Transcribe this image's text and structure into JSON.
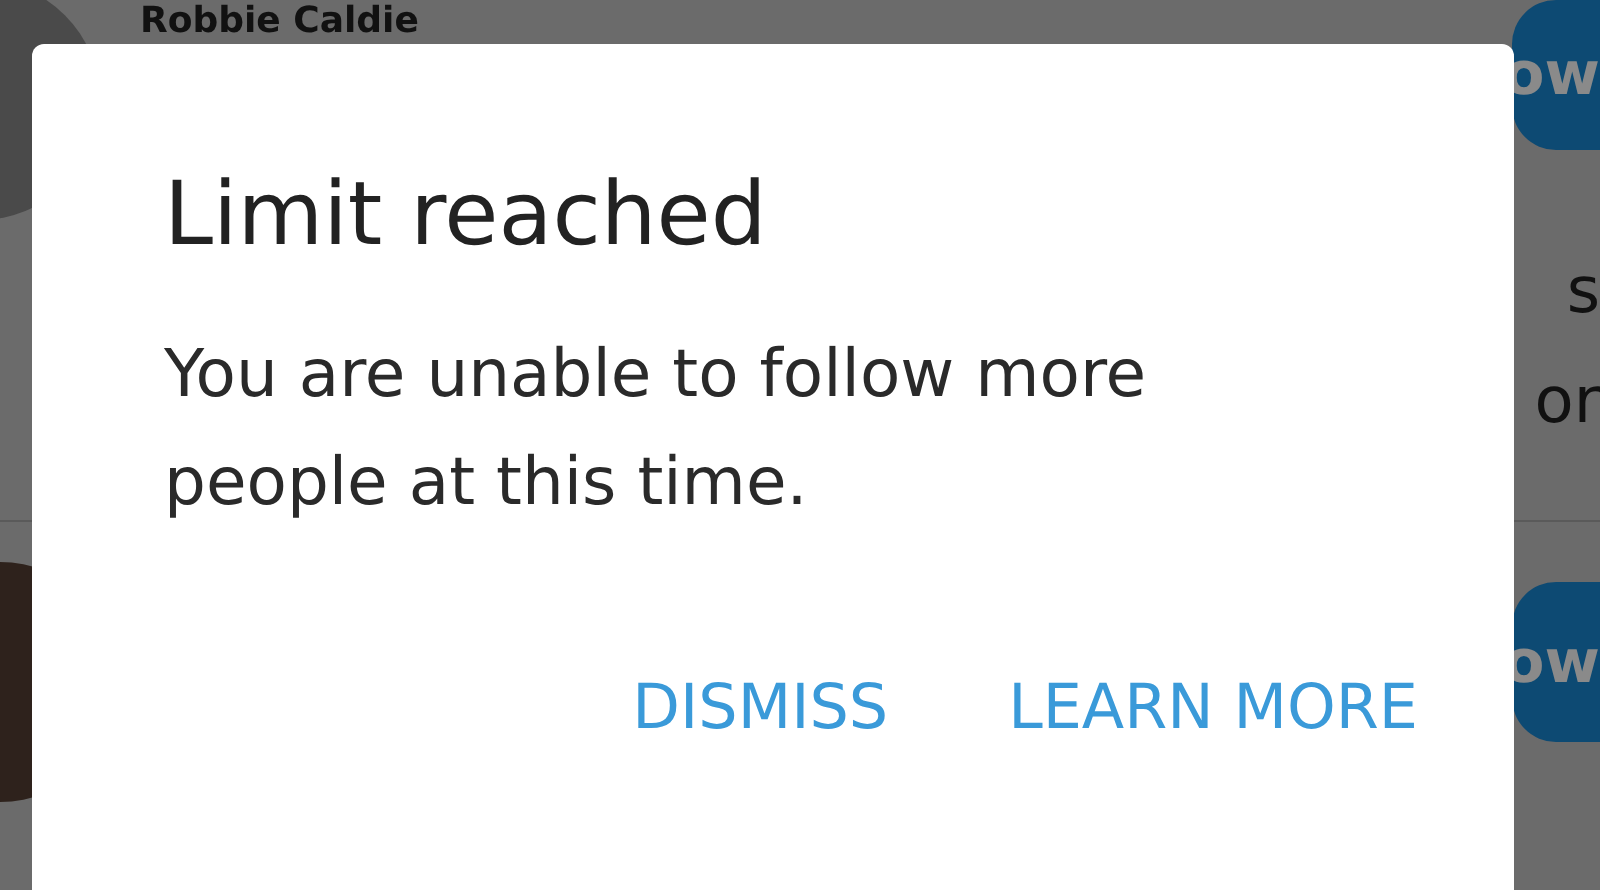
{
  "background": {
    "rows": [
      {
        "name": "Robbie Caldie",
        "button": "ow",
        "snippets": [
          "s",
          "or"
        ]
      },
      {
        "button": "ow"
      }
    ]
  },
  "dialog": {
    "title": "Limit reached",
    "message": "You are unable to follow more people at this time.",
    "actions": [
      {
        "label": "DISMISS"
      },
      {
        "label": "LEARN MORE"
      }
    ]
  }
}
